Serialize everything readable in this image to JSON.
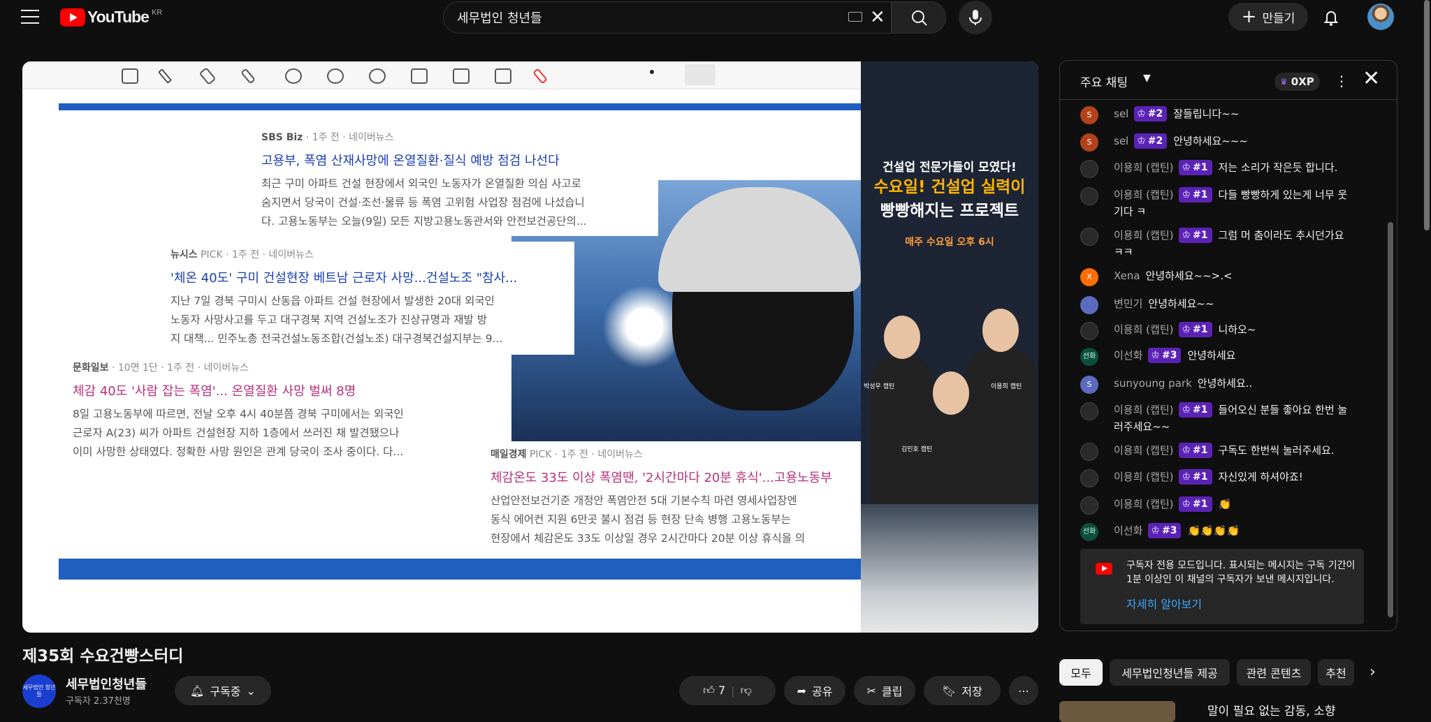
{
  "header": {
    "logo_text": "YouTube",
    "region": "KR",
    "search_value": "세무법인 청년들",
    "create_label": "만들기"
  },
  "video": {
    "sources": [
      {
        "name": "SBS Biz",
        "meta": "· 1주 전 · 네이버뉴스",
        "title": "고용부, 폭염 산재사망에 온열질환·질식 예방 점검 나선다",
        "body": [
          "최근 구미 아파트 건설 현장에서 외국인 노동자가 온열질환 의심 사고로",
          "숨지면서 당국이 건설·조선·물류 등 폭염 고위험 사업장 점검에 나섰습니",
          "다. 고용노동부는 오늘(9일) 모든 지방고용노동관서와 안전보건공단의..."
        ]
      },
      {
        "name": "뉴시스",
        "meta": "PICK · 1주 전 · 네이버뉴스",
        "title": "'체온 40도' 구미 건설현장 베트남 근로자 사망...건설노조 \"참사...",
        "body": [
          "지난 7일 경북 구미시 산동읍 아파트 건설 현장에서 발생한 20대 외국인",
          "노동자 사망사고를 두고 대구경북 지역 건설노조가 진상규명과 재발 방",
          "지 대책... 민주노총 전국건설노동조합(건설노조) 대구경북건설지부는 9..."
        ]
      },
      {
        "name": "문화일보",
        "meta": "· 10면 1단 · 1주 전 · 네이버뉴스",
        "title": "체감 40도 '사람 잡는 폭염'... 온열질환 사망 벌써 8명",
        "body": [
          "8일 고용노동부에 따르면, 전날 오후 4시 40분쯤 경북 구미에서는 외국인",
          "근로자 A(23) 씨가 아파트 건설현장 지하 1층에서 쓰러진 채 발견됐으나",
          "이미 사망한 상태였다. 정확한 사망 원인은 관계 당국이 조사 중이다. 다..."
        ]
      },
      {
        "name": "매일경제",
        "meta": "PICK · 1주 전 · 네이버뉴스",
        "title": "체감온도 33도 이상 폭염땐, '2시간마다 20분 휴식'...고용노동부",
        "body": [
          "산업안전보건기준 개정안 폭염안전 5대 기본수칙 마련 영세사업장엔",
          "동식 에어컨 지원 6만곳 불시 점검 등 현장 단속 병행 고용노동부는",
          "현장에서 체감온도 33도 이상일 경우 2시간마다 20분 이상 휴식을 의"
        ]
      }
    ],
    "promo": {
      "line1": "건설업 전문가들이 모였다!",
      "line2a": "수요일! 건설업 실력이",
      "line2b": "빵빵해지는 프로젝트",
      "line3": "매주 수요일 오후 6시",
      "people": [
        "박성우 캡틴",
        "김민호 캡틴",
        "이용희 캡틴"
      ]
    }
  },
  "chat": {
    "title": "주요 채팅",
    "xp": "0XP",
    "messages": [
      {
        "avatar": "S",
        "name": "sel",
        "badge": "#2",
        "text": "잘들립니다~~"
      },
      {
        "avatar": "S",
        "name": "sel",
        "badge": "#2",
        "text": "안녕하세요~~~"
      },
      {
        "avatar": "",
        "name": "이용희 (캡틴)",
        "badge": "#1",
        "text": "저는 소리가 작은듯 합니다."
      },
      {
        "avatar": "",
        "name": "이용희 (캡틴)",
        "badge": "#1",
        "text": "다들 빵빵하게 있는게 너무 웃",
        "text2": "기다 ㅋ"
      },
      {
        "avatar": "",
        "name": "이용희 (캡틴)",
        "badge": "#1",
        "text": "그럼 머 춤이라도 추시던가요",
        "text2": "ㅋㅋ"
      },
      {
        "avatar": "X",
        "name": "Xena",
        "badge": "",
        "text": "안녕하세요~~>.<"
      },
      {
        "avatar": "",
        "name": "변민기",
        "badge": "",
        "text": "안녕하세요~~"
      },
      {
        "avatar": "",
        "name": "이용희 (캡틴)",
        "badge": "#1",
        "text": "니하오~"
      },
      {
        "avatar": "선화",
        "name": "이선화",
        "badge": "#3",
        "text": "안녕하세요"
      },
      {
        "avatar": "S",
        "name": "sunyoung park",
        "badge": "",
        "text": "안녕하세요.."
      },
      {
        "avatar": "",
        "name": "이용희 (캡틴)",
        "badge": "#1",
        "text": "들어오신 분들 좋아요 한번 눌",
        "text2": "러주세요~~"
      },
      {
        "avatar": "",
        "name": "이용희 (캡틴)",
        "badge": "#1",
        "text": "구독도 한번씩 눌러주세요."
      },
      {
        "avatar": "",
        "name": "이용희 (캡틴)",
        "badge": "#1",
        "text": "자신있게 하셔야죠!"
      },
      {
        "avatar": "",
        "name": "이용희 (캡틴)",
        "badge": "#1",
        "text": "👏"
      },
      {
        "avatar": "선화",
        "name": "이선화",
        "badge": "#3",
        "text": "👏👏👏👏"
      }
    ],
    "notice_text": "구독자 전용 모드입니다. 표시되는 메시지는 구독 기간이 1분 이상인 이 채널의 구독자가 보낸 메시지입니다.",
    "notice_link": "자세히 알아보기"
  },
  "info": {
    "title": "제35회 수요건빵스터디",
    "channel": "세무법인청년들",
    "channel_avatar": "세무법인 청년들",
    "subs": "구독자 2.37천명",
    "subscribe_label": "구독중",
    "likes": "7",
    "share": "공유",
    "clip": "클립",
    "save": "저장"
  },
  "chips": [
    "모두",
    "세무법인청년들 제공",
    "관련 콘텐츠",
    "추천"
  ],
  "rec_title": "말이 필요 없는 감동, 소향"
}
